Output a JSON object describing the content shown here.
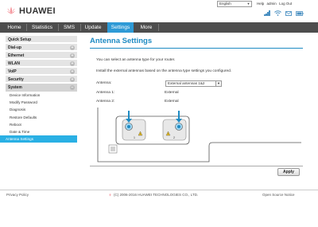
{
  "header": {
    "brand": "HUAWEI",
    "language": "English",
    "help": "Help",
    "user": "admin",
    "logout": "Log Out"
  },
  "nav": {
    "tabs": [
      "Home",
      "Statistics",
      "SMS",
      "Update",
      "Settings",
      "More"
    ],
    "active": "Settings"
  },
  "sidebar": {
    "items": [
      {
        "label": "Quick Setup",
        "expandable": false
      },
      {
        "label": "Dial-up",
        "expandable": true
      },
      {
        "label": "Ethernet",
        "expandable": true
      },
      {
        "label": "WLAN",
        "expandable": true
      },
      {
        "label": "VoIP",
        "expandable": true
      },
      {
        "label": "Security",
        "expandable": true
      },
      {
        "label": "System",
        "expandable": true,
        "expanded": true
      }
    ],
    "expand_symbol": "+",
    "collapse_symbol": "−",
    "system_sub": [
      "Device Information",
      "Modify Password",
      "Diagnosis",
      "Restore Defaults",
      "Reboot",
      "Date & Time",
      "Antenna Settings"
    ],
    "active_sub": "Antenna Settings"
  },
  "main": {
    "title": "Antenna Settings",
    "desc1": "You can select an antenna type for your router.",
    "desc2": "Install the external antennas based on the antenna type settings you configured.",
    "antenna_label": "Antenna:",
    "antenna_value": "External antennas 1&2",
    "antenna1_label": "Antenna 1:",
    "antenna1_value": "External",
    "antenna2_label": "Antenna 2:",
    "antenna2_value": "External",
    "port1_label": "1",
    "port2_label": "2",
    "apply": "Apply"
  },
  "footer": {
    "privacy": "Privacy Policy",
    "copyright": "(C) 2006-2016 HUAWEI TECHNOLOGIES CO., LTD.",
    "notice": "Open Source Notice"
  },
  "colors": {
    "nav_bg": "#4d4d4d",
    "accent": "#2e9ad6",
    "title": "#1e8bc3",
    "active_sub": "#2ab0e4",
    "brand_red": "#e60012"
  },
  "icons": {
    "logo": "huawei-flower-icon",
    "signal": "signal-strength-icon",
    "wifi": "wifi-icon",
    "message": "message-icon",
    "battery": "battery-icon"
  }
}
